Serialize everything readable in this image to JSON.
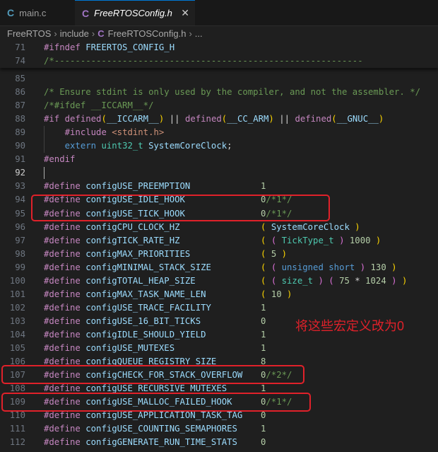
{
  "tabs": [
    {
      "icon": "C",
      "label": "main.c"
    },
    {
      "icon": "C",
      "label": "FreeRTOSConfig.h",
      "close": "✕"
    }
  ],
  "breadcrumb": {
    "parts": [
      "FreeRTOS",
      "include",
      "FreeRTOSConfig.h",
      "..."
    ],
    "sep": "›"
  },
  "sticky_lines": [
    {
      "n": "71",
      "text": "#ifndef FREERTOS_CONFIG_H"
    },
    {
      "n": "74",
      "text": "/*-----------------------------------------------------------"
    }
  ],
  "lines": [
    {
      "n": "85",
      "text": ""
    },
    {
      "n": "86",
      "text": "/* Ensure stdint is only used by the compiler, and not the assembler. */"
    },
    {
      "n": "87",
      "text": "/*#ifdef __ICCARM__*/"
    },
    {
      "n": "88",
      "text": "#if defined(__ICCARM__) || defined(__CC_ARM) || defined(__GNUC__)"
    },
    {
      "n": "89",
      "text": "    #include <stdint.h>"
    },
    {
      "n": "90",
      "text": "    extern uint32_t SystemCoreClock;"
    },
    {
      "n": "91",
      "text": "#endif"
    },
    {
      "n": "92",
      "text": ""
    },
    {
      "n": "93",
      "text": "#define configUSE_PREEMPTION",
      "value": "1"
    },
    {
      "n": "94",
      "text": "#define configUSE_IDLE_HOOK",
      "value": "0/*1*/"
    },
    {
      "n": "95",
      "text": "#define configUSE_TICK_HOOK",
      "value": "0/*1*/"
    },
    {
      "n": "96",
      "text": "#define configCPU_CLOCK_HZ",
      "value": "( SystemCoreClock )"
    },
    {
      "n": "97",
      "text": "#define configTICK_RATE_HZ",
      "value": "( ( TickType_t ) 1000 )"
    },
    {
      "n": "98",
      "text": "#define configMAX_PRIORITIES",
      "value": "( 5 )"
    },
    {
      "n": "99",
      "text": "#define configMINIMAL_STACK_SIZE",
      "value": "( ( unsigned short ) 130 )"
    },
    {
      "n": "100",
      "text": "#define configTOTAL_HEAP_SIZE",
      "value": "( ( size_t ) ( 75 * 1024 ) )"
    },
    {
      "n": "101",
      "text": "#define configMAX_TASK_NAME_LEN",
      "value": "( 10 )"
    },
    {
      "n": "102",
      "text": "#define configUSE_TRACE_FACILITY",
      "value": "1"
    },
    {
      "n": "103",
      "text": "#define configUSE_16_BIT_TICKS",
      "value": "0"
    },
    {
      "n": "104",
      "text": "#define configIDLE_SHOULD_YIELD",
      "value": "1"
    },
    {
      "n": "105",
      "text": "#define configUSE_MUTEXES",
      "value": "1"
    },
    {
      "n": "106",
      "text": "#define configQUEUE_REGISTRY_SIZE",
      "value": "8"
    },
    {
      "n": "107",
      "text": "#define configCHECK_FOR_STACK_OVERFLOW",
      "value": "0/*2*/"
    },
    {
      "n": "108",
      "text": "#define configUSE_RECURSIVE_MUTEXES",
      "value": "1"
    },
    {
      "n": "109",
      "text": "#define configUSE_MALLOC_FAILED_HOOK",
      "value": "0/*1*/"
    },
    {
      "n": "110",
      "text": "#define configUSE_APPLICATION_TASK_TAG",
      "value": "0"
    },
    {
      "n": "111",
      "text": "#define configUSE_COUNTING_SEMAPHORES",
      "value": "1"
    },
    {
      "n": "112",
      "text": "#define configGENERATE_RUN_TIME_STATS",
      "value": "0"
    }
  ],
  "current_line": "92",
  "annotation": {
    "text": "将这些宏定义改为0",
    "color": "#e0212a"
  },
  "colors": {
    "accent": "#0078d4",
    "c_icon_main": "#519aba",
    "c_icon_header": "#a074c4",
    "highlight": "#e0212a"
  }
}
